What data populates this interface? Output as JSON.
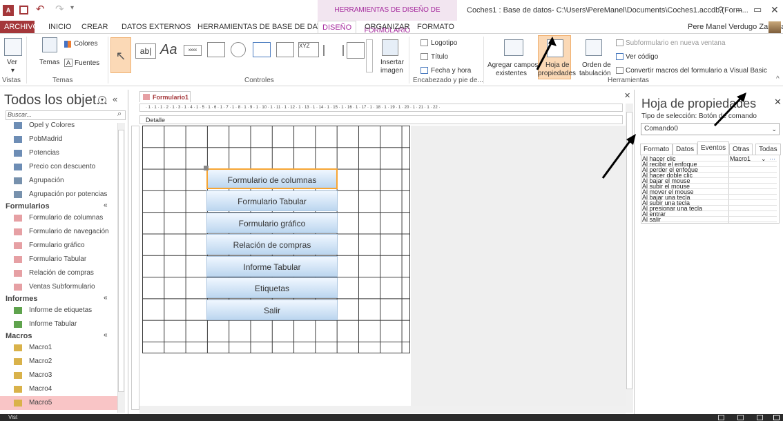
{
  "window": {
    "title": "Coches1 : Base de datos- C:\\Users\\PereManel\\Documents\\Coches1.accdb (Form...",
    "context_tab": "HERRAMIENTAS DE DISEÑO DE FORMULARIO",
    "user": "Pere Manel Verdugo Zamora",
    "help": "?",
    "minimize": "–",
    "restore": "▭",
    "close": "✕"
  },
  "tabs": [
    {
      "label": "ARCHIVO"
    },
    {
      "label": "INICIO"
    },
    {
      "label": "CREAR"
    },
    {
      "label": "DATOS EXTERNOS"
    },
    {
      "label": "HERRAMIENTAS DE BASE DE DATOS"
    },
    {
      "label": "DISEÑO"
    },
    {
      "label": "ORGANIZAR"
    },
    {
      "label": "FORMATO"
    }
  ],
  "ribbon": {
    "vistas": {
      "ver": "Ver",
      "group": "Vistas"
    },
    "temas": {
      "temas": "Temas",
      "colores": "Colores",
      "fuentes": "Fuentes",
      "group": "Temas"
    },
    "controles": {
      "group": "Controles",
      "insertar": "Insertar",
      "imagen": "imagen"
    },
    "encabezado": {
      "logotipo": "Logotipo",
      "titulo": "Título",
      "fecha": "Fecha y hora",
      "group": "Encabezado y pie de..."
    },
    "herramientas": {
      "agregar1": "Agregar campos",
      "agregar2": "existentes",
      "hoja1": "Hoja de",
      "hoja2": "propiedades",
      "orden1": "Orden de",
      "orden2": "tabulación",
      "subform": "Subformulario en nueva ventana",
      "vercodigo": "Ver código",
      "convertir": "Convertir macros del formulario a Visual Basic",
      "group": "Herramientas"
    }
  },
  "nav": {
    "title": "Todos los objet...",
    "search_placeholder": "Buscar...",
    "items": [
      {
        "label": "Opel y Colores"
      },
      {
        "label": "PobMadrid"
      },
      {
        "label": "Potencias"
      },
      {
        "label": "Precio con descuento"
      },
      {
        "label": "Agrupación"
      },
      {
        "label": "Agrupación por potencias"
      }
    ],
    "formularios": {
      "header": "Formularios",
      "items": [
        {
          "label": "Formulario de columnas"
        },
        {
          "label": "Formulario de navegación"
        },
        {
          "label": "Formulario gráfico"
        },
        {
          "label": "Formulario Tabular"
        },
        {
          "label": "Relación de compras"
        },
        {
          "label": "Ventas Subformulario"
        }
      ]
    },
    "informes": {
      "header": "Informes",
      "items": [
        {
          "label": "Informe de etiquetas"
        },
        {
          "label": "Informe Tabular"
        }
      ]
    },
    "macros": {
      "header": "Macros",
      "items": [
        {
          "label": "Macro1"
        },
        {
          "label": "Macro2"
        },
        {
          "label": "Macro3"
        },
        {
          "label": "Macro4"
        },
        {
          "label": "Macro5"
        }
      ]
    }
  },
  "doc": {
    "tab": "Formulario1",
    "section": "Detalle",
    "ruler": "· 1 · 1 · 1 · 2 · 1 · 3 · 1 · 4 · 1 · 5 · 1 · 6 · 1 · 7 · 1 · 8 · 1 · 9 · 1 · 10 · 1 · 11 · 1 · 12 · 1 · 13 · 1 · 14 · 1 · 15 · 1 · 16 · 1 · 17 · 1 · 18 · 1 · 19 · 1 · 20 · 1 · 21 · 1 · 22 ·",
    "buttons": [
      {
        "label": "Formulario de columnas"
      },
      {
        "label": "Formulario Tabular"
      },
      {
        "label": "Formulario gráfico"
      },
      {
        "label": "Relación de compras"
      },
      {
        "label": "Informe Tabular"
      },
      {
        "label": "Etiquetas"
      },
      {
        "label": "Salir"
      }
    ]
  },
  "props": {
    "title": "Hoja de propiedades",
    "selection_label": "Tipo de selección:  Botón de comando",
    "object": "Comando0",
    "tabs": [
      {
        "label": "Formato"
      },
      {
        "label": "Datos"
      },
      {
        "label": "Eventos"
      },
      {
        "label": "Otras"
      },
      {
        "label": "Todas"
      }
    ],
    "rows": [
      {
        "name": "Al hacer clic",
        "value": "Macro1"
      },
      {
        "name": "Al recibir el enfoque",
        "value": ""
      },
      {
        "name": "Al perder el enfoque",
        "value": ""
      },
      {
        "name": "Al hacer doble clic",
        "value": ""
      },
      {
        "name": "Al bajar el mouse",
        "value": ""
      },
      {
        "name": "Al subir el mouse",
        "value": ""
      },
      {
        "name": "Al mover el mouse",
        "value": ""
      },
      {
        "name": "Al bajar una tecla",
        "value": ""
      },
      {
        "name": "Al subir una tecla",
        "value": ""
      },
      {
        "name": "Al presionar una tecla",
        "value": ""
      },
      {
        "name": "Al entrar",
        "value": ""
      },
      {
        "name": "Al salir",
        "value": ""
      }
    ]
  },
  "status": {
    "left": "Vist"
  },
  "colors": {
    "access_red": "#a4373a",
    "context_purple": "#a4289c",
    "selected_orange": "#f7a533",
    "button_blue": "#bcd6ef"
  }
}
